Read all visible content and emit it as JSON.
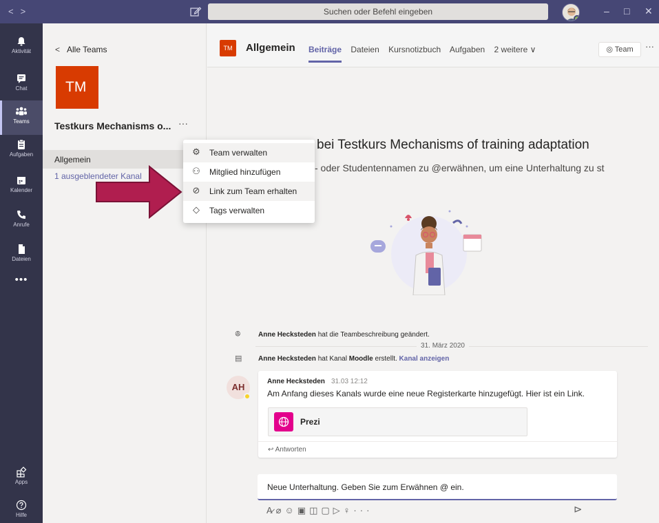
{
  "titlebar": {
    "back": "<",
    "forward": ">",
    "search_placeholder": "Suchen oder Befehl eingeben",
    "minimize": "–",
    "maximize": "□",
    "close": "✕"
  },
  "rail": {
    "items": [
      {
        "label": "Aktivität"
      },
      {
        "label": "Chat"
      },
      {
        "label": "Teams"
      },
      {
        "label": "Aufgaben"
      },
      {
        "label": "Kalender"
      },
      {
        "label": "Anrufe"
      },
      {
        "label": "Dateien"
      }
    ],
    "more": "•••",
    "apps": "Apps",
    "help": "Hilfe"
  },
  "leftpanel": {
    "back_label": "Alle Teams",
    "team_initials": "TM",
    "team_name": "Testkurs Mechanisms o...",
    "team_more": "···",
    "channels": [
      {
        "label": "Allgemein"
      }
    ],
    "hidden_channels": "1 ausgeblendeter Kanal"
  },
  "header": {
    "team_initials": "TM",
    "channel_title": "Allgemein",
    "tabs": [
      {
        "label": "Beiträge"
      },
      {
        "label": "Dateien"
      },
      {
        "label": "Kursnotizbuch"
      },
      {
        "label": "Aufgaben"
      },
      {
        "label": "2 weitere ∨"
      }
    ],
    "team_button": "◎ Team",
    "more": "···"
  },
  "welcome": {
    "title": "bei Testkurs Mechanisms of training adaptation",
    "subtitle": "- oder Studentennamen zu @erwähnen, um eine Unterhaltung zu st"
  },
  "activity": [
    {
      "icon": "ꔮ",
      "author": "Anne Hecksteden",
      "text": " hat die Teambeschreibung geändert."
    },
    {
      "icon": "▤",
      "author": "Anne Hecksteden",
      "text": " hat Kanal ",
      "channel": "Moodle",
      "text2": " erstellt. ",
      "link": "Kanal anzeigen"
    }
  ],
  "date_separator": "31. März 2020",
  "message": {
    "initials": "AH",
    "author": "Anne Hecksteden",
    "time": "31.03 12:12",
    "text": "Am Anfang dieses Kanals wurde eine neue Registerkarte hinzugefügt. Hier ist ein Link.",
    "attachment": "Prezi",
    "reply": "↩ Antworten"
  },
  "compose": {
    "placeholder": "Neue Unterhaltung. Geben Sie zum Erwähnen @ ein."
  },
  "context_menu": {
    "items": [
      {
        "icon": "⚙",
        "label": "Team verwalten"
      },
      {
        "icon": "⚇",
        "label": "Mitglied hinzufügen"
      },
      {
        "icon": "⊘",
        "label": "Link zum Team erhalten"
      },
      {
        "icon": "◇",
        "label": "Tags verwalten"
      }
    ]
  },
  "colors": {
    "titlebar": "#464775",
    "rail": "#33344a",
    "accent": "#6264a7",
    "team_tile": "#d83b01",
    "prezi": "#e3008c",
    "arrow": "#b01e4f"
  }
}
